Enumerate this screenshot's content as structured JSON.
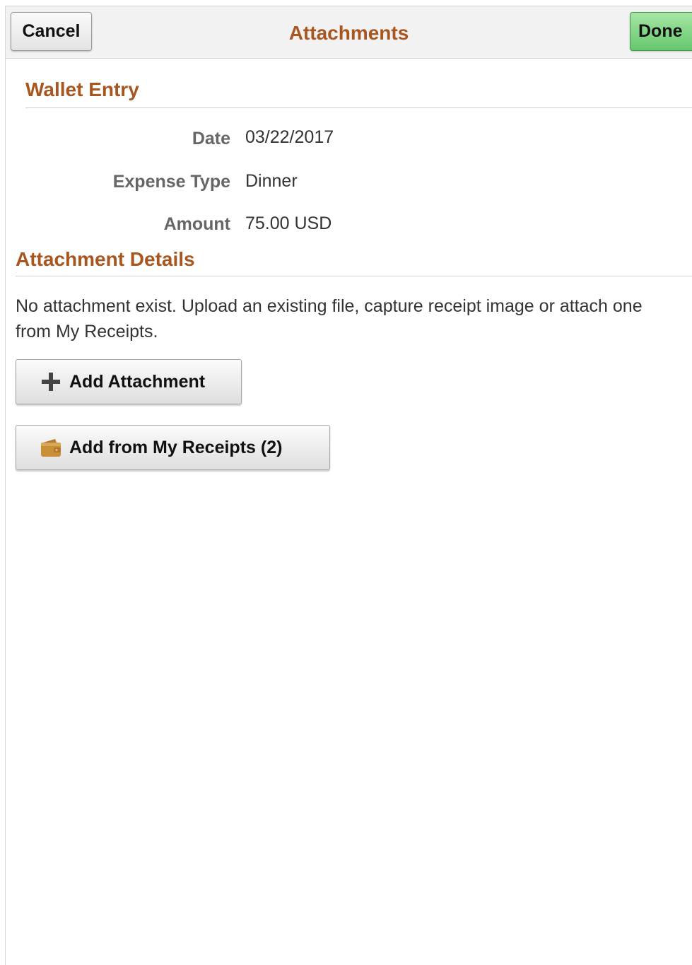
{
  "header": {
    "title": "Attachments",
    "cancel_label": "Cancel",
    "done_label": "Done"
  },
  "wallet_entry": {
    "title": "Wallet Entry",
    "fields": [
      {
        "label": "Date",
        "value": "03/22/2017"
      },
      {
        "label": "Expense Type",
        "value": "Dinner"
      },
      {
        "label": "Amount",
        "value": "75.00 USD"
      }
    ]
  },
  "attachment_details": {
    "title": "Attachment Details",
    "message": "No attachment exist. Upload an existing file, capture receipt image or attach one from My Receipts.",
    "add_attachment_label": "Add Attachment",
    "add_from_receipts_label": "Add from My Receipts (2)"
  },
  "icons": {
    "add": "plus-icon",
    "receipts": "wallet-icon"
  },
  "colors": {
    "section_title": "#a8561f",
    "done_button": "#66c76e"
  }
}
